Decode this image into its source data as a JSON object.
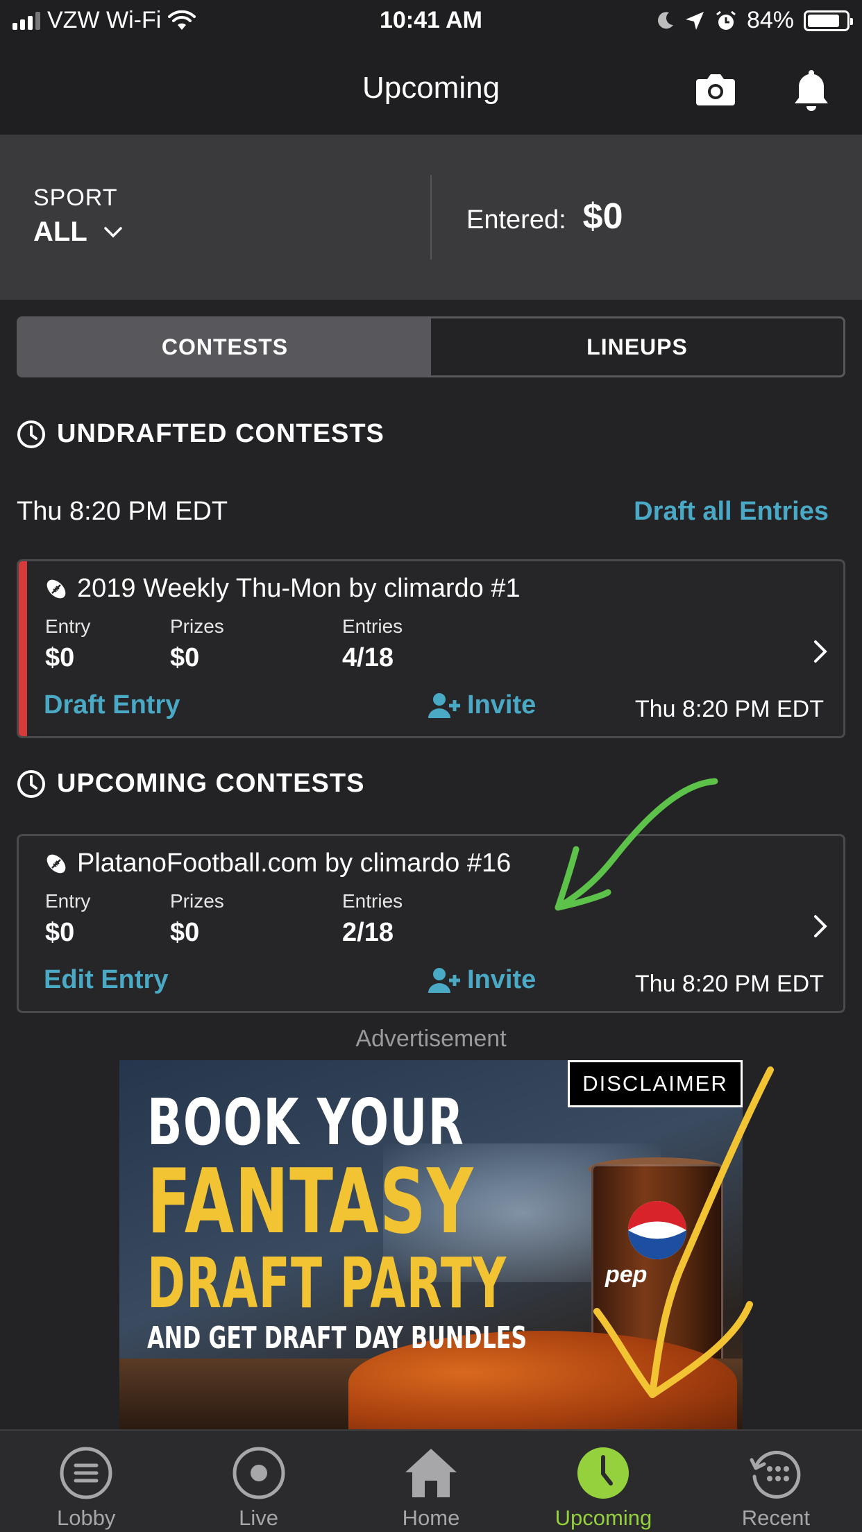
{
  "status_bar": {
    "carrier": "VZW Wi-Fi",
    "time": "10:41 AM",
    "battery": "84%",
    "battery_level": 0.84
  },
  "nav": {
    "title": "Upcoming",
    "camera_icon": "camera-icon",
    "bell_icon": "bell-icon"
  },
  "filter": {
    "sport_label": "SPORT",
    "sport_value": "ALL",
    "entered_label": "Entered:",
    "entered_value": "$0"
  },
  "tabs": {
    "contests": "CONTESTS",
    "lineups": "LINEUPS",
    "active": "contests"
  },
  "undrafted": {
    "heading": "UNDRAFTED CONTESTS",
    "date": "Thu 8:20 PM EDT",
    "draft_all": "Draft all Entries",
    "contest": {
      "title": "2019 Weekly Thu-Mon by climardo #1",
      "entry_label": "Entry",
      "entry_value": "$0",
      "prizes_label": "Prizes",
      "prizes_value": "$0",
      "entries_label": "Entries",
      "entries_value": "4/18",
      "action": "Draft Entry",
      "invite": "Invite",
      "time": "Thu 8:20 PM EDT"
    }
  },
  "upcoming": {
    "heading": "UPCOMING CONTESTS",
    "contest": {
      "title": "PlatanoFootball.com by climardo #16",
      "entry_label": "Entry",
      "entry_value": "$0",
      "prizes_label": "Prizes",
      "prizes_value": "$0",
      "entries_label": "Entries",
      "entries_value": "2/18",
      "action": "Edit Entry",
      "invite": "Invite",
      "time": "Thu 8:20 PM EDT"
    }
  },
  "ad": {
    "label": "Advertisement",
    "disclaimer": "DISCLAIMER",
    "line1": "BOOK YOUR",
    "line2": "FANTASY",
    "line3": "DRAFT PARTY",
    "line4": "AND GET DRAFT DAY BUNDLES",
    "cup_text": "pep"
  },
  "tabbar": {
    "items": [
      {
        "label": "Lobby",
        "icon": "lobby-icon"
      },
      {
        "label": "Live",
        "icon": "live-icon"
      },
      {
        "label": "Home",
        "icon": "home-icon"
      },
      {
        "label": "Upcoming",
        "icon": "clock-icon"
      },
      {
        "label": "Recent",
        "icon": "recent-icon"
      }
    ],
    "active_index": 3
  },
  "colors": {
    "accent_blue": "#4aa9c5",
    "accent_green": "#95d13c",
    "flag_red": "#d63a3a",
    "ad_yellow": "#f2c433"
  }
}
